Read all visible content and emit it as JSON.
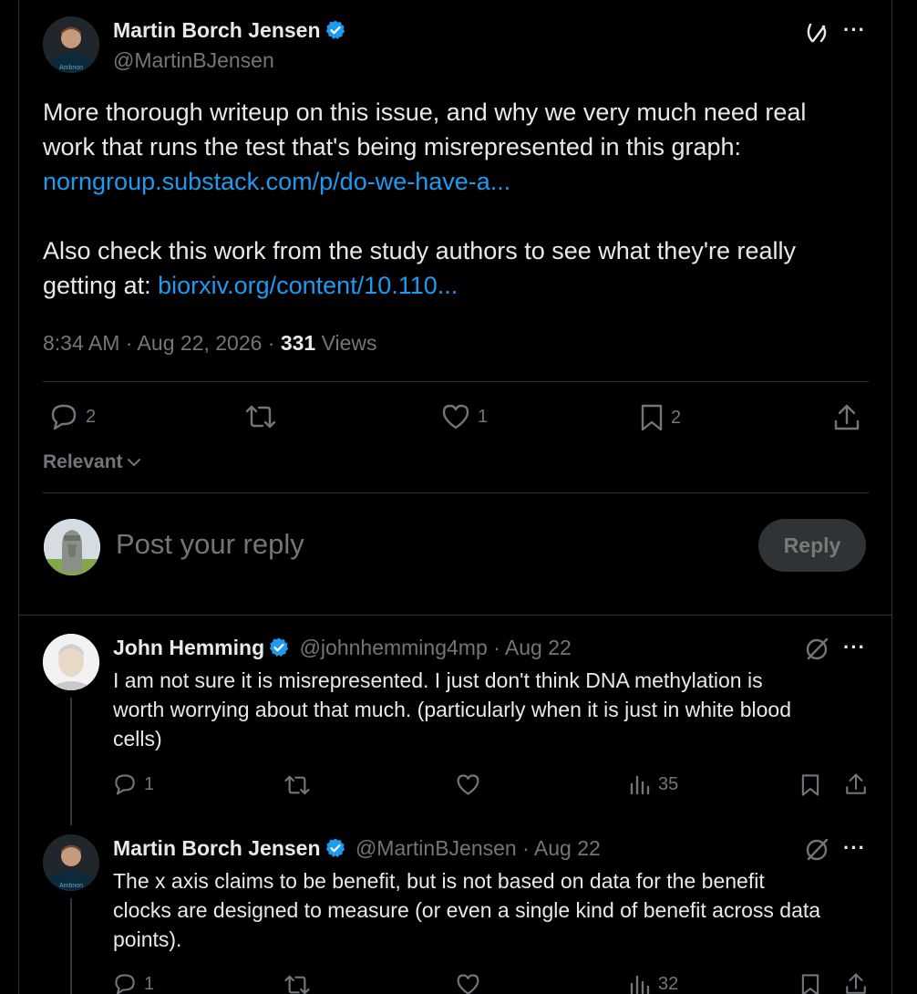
{
  "main_post": {
    "author_name": "Martin Borch Jensen",
    "author_handle": "@MartinBJensen",
    "text_line1": "More thorough writeup on this issue, and why we very much need real",
    "text_line2": "work that runs the test that's being misrepresented in this graph:",
    "link1": "norngroup.substack.com/p/do-we-have-a...",
    "text_line4": "Also check this work from the study authors to see what they're really",
    "text_line5_prefix": "getting at: ",
    "link2": "biorxiv.org/content/10.110...",
    "time_date": "8:34 AM · Aug 22, 2026 · ",
    "views_count": "331",
    "views_label": " Views",
    "replies": "2",
    "likes": "1",
    "bookmarks": "2"
  },
  "sort": {
    "label": "Relevant"
  },
  "composer": {
    "placeholder": "Post your reply",
    "button": "Reply"
  },
  "replies": [
    {
      "author_name": "John Hemming",
      "meta": "@johnhemming4mp · Aug 22",
      "line1": "I am not sure it is misrepresented.  I just don't think DNA methylation is",
      "line2": "worth worrying about that much.  (particularly when it is just in white blood",
      "line3": "cells)",
      "replies": "1",
      "views": "35"
    },
    {
      "author_name": "Martin Borch Jensen",
      "meta": "@MartinBJensen · Aug 22",
      "line1": "The x axis claims to be benefit, but is not based on data for the benefit",
      "line2": "clocks are designed to measure (or even a single kind of benefit across data",
      "line3": "points).",
      "replies": "1",
      "views": "32"
    }
  ],
  "icons": {
    "more": "···",
    "grok": "grok-icon",
    "verified": "verified-badge-icon"
  },
  "colors": {
    "background": "#000000",
    "link": "#1d9bf0",
    "verified": "#1d9bf0",
    "muted": "#71767b",
    "divider": "#2f3336"
  }
}
